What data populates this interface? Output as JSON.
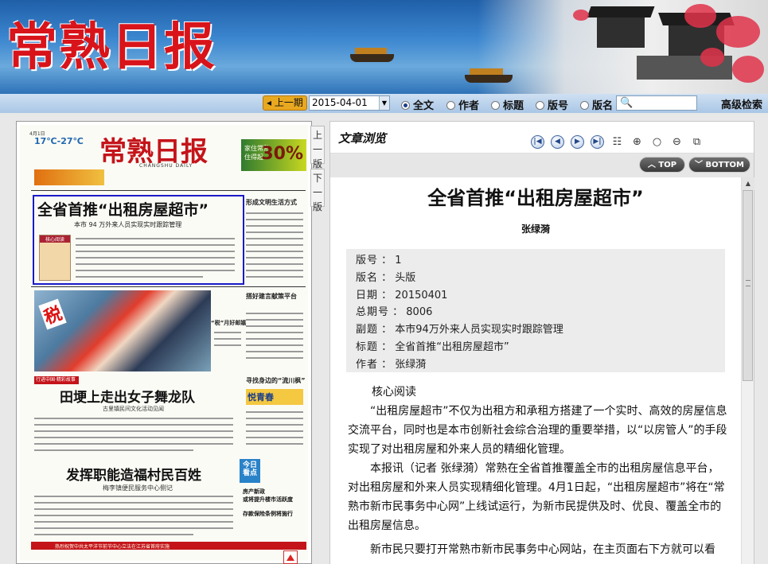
{
  "banner": {
    "logo": "常熟日报"
  },
  "searchbar": {
    "prev_label": "上一期",
    "date_value": "2015-04-01",
    "options": [
      "全文",
      "作者",
      "标题",
      "版号",
      "版名"
    ],
    "selected": "全文",
    "advanced_label": "高级检索"
  },
  "paper": {
    "masthead": "常熟日报",
    "masthead_en": "CHANGSHU DAILY",
    "date": "4月1日",
    "weather": "17℃-27℃",
    "ad_percent": "30%",
    "ad_text": "家住常熟 住得起",
    "headline": "全省首推“出租房屋超市”",
    "headline_sub": "本市 94 万外来人员实现实时跟踪管理",
    "core_label": "核心阅读",
    "side_items": [
      "形成文明生活方式",
      "搭好建言献策平台",
      "寻找身边的“流川枫”"
    ],
    "photo_tag": "税",
    "photo_caption": "“税”月好邮嬉",
    "section_tag": "行进中国·精彩故事",
    "story2_title": "田埂上走出女子舞龙队",
    "story2_sub": "古里镇民间文化活动见闻",
    "story3_title": "发挥职能造福村民百姓",
    "story3_sub": "梅李镇便民服务中心侧记",
    "yuqing": "悦青春",
    "today_label": "今日看点",
    "today_items": [
      "房产新政",
      "或将提升楼市活跃度",
      "存款保险条例将施行"
    ],
    "bottom_strip": "热烈祝贺中共太平洋节前节中心立法在江苏省首府实施",
    "pages": [
      "上一版",
      "下一版"
    ]
  },
  "article": {
    "panel_title": "文章浏览",
    "top_label": "TOP",
    "bottom_label": "BOTTOM",
    "title": "全省首推“出租房屋超市”",
    "author": "张绿漪",
    "meta": [
      {
        "k": "版号",
        "v": "1"
      },
      {
        "k": "版名",
        "v": "头版"
      },
      {
        "k": "日期",
        "v": "20150401"
      },
      {
        "k": "总期号",
        "v": "8006"
      },
      {
        "k": "副题",
        "v": "本市94万外来人员实现实时跟踪管理"
      },
      {
        "k": "标题",
        "v": "全省首推“出租房屋超市”"
      },
      {
        "k": "作者",
        "v": "张绿漪"
      }
    ],
    "para1": "核心阅读",
    "para2": "“出租房屋超市”不仅为出租方和承租方搭建了一个实时、高效的房屋信息交流平台，同时也是本市创新社会综合治理的重要举措，以“以房管人”的手段实现了对出租房屋和外来人员的精细化管理。",
    "para3": "本报讯（记者 张绿漪）常熟在全省首推覆盖全市的出租房屋信息平台，对出租房屋和外来人员实现精细化管理。4月1日起，“出租房屋超市”将在“常熟市新市民事务中心网”上线试运行，为新市民提供及时、优良、覆盖全市的出租房屋信息。",
    "para4": "新市民只要打开常熟市新市民事务中心网站，在主页面右下方就可以看"
  }
}
